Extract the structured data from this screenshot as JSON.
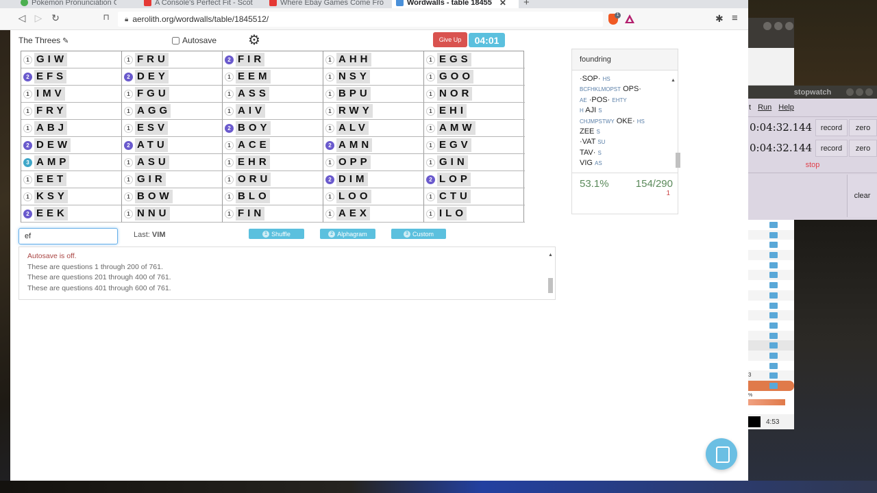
{
  "browser": {
    "tabs": [
      {
        "label": "Pokemon Pronunciation Gui",
        "favicon_color": "#4caf50"
      },
      {
        "label": "A Console's Perfect Fit - Scot",
        "favicon_color": "#e53935"
      },
      {
        "label": "Where Ebay Games Come Fro",
        "favicon_color": "#e53935"
      },
      {
        "label": "Wordwalls - table 18455",
        "favicon_color": "#4a90d9",
        "active": true
      }
    ],
    "url": "aerolith.org/wordwalls/table/1845512/",
    "brave_badge": "1"
  },
  "header": {
    "title": "The Threes",
    "autosave_label": "Autosave",
    "autosave_checked": false,
    "give_up_label": "Give Up",
    "timer": "04:01"
  },
  "grid": [
    {
      "count": 1,
      "word": "GIW"
    },
    {
      "count": 1,
      "word": "FRU"
    },
    {
      "count": 2,
      "word": "FIR"
    },
    {
      "count": 1,
      "word": "AHH"
    },
    {
      "count": 1,
      "word": "EGS"
    },
    {
      "count": 2,
      "word": "EFS"
    },
    {
      "count": 2,
      "word": "DEY"
    },
    {
      "count": 1,
      "word": "EEM"
    },
    {
      "count": 1,
      "word": "NSY"
    },
    {
      "count": 1,
      "word": "GOO"
    },
    {
      "count": 1,
      "word": "IMV"
    },
    {
      "count": 1,
      "word": "FGU"
    },
    {
      "count": 1,
      "word": "ASS"
    },
    {
      "count": 1,
      "word": "BPU"
    },
    {
      "count": 1,
      "word": "NOR"
    },
    {
      "count": 1,
      "word": "FRY"
    },
    {
      "count": 1,
      "word": "AGG"
    },
    {
      "count": 1,
      "word": "AIV"
    },
    {
      "count": 1,
      "word": "RWY"
    },
    {
      "count": 1,
      "word": "EHI"
    },
    {
      "count": 1,
      "word": "ABJ"
    },
    {
      "count": 1,
      "word": "ESV"
    },
    {
      "count": 2,
      "word": "BOY"
    },
    {
      "count": 1,
      "word": "ALV"
    },
    {
      "count": 1,
      "word": "AMW"
    },
    {
      "count": 2,
      "word": "DEW"
    },
    {
      "count": 2,
      "word": "ATU"
    },
    {
      "count": 1,
      "word": "ACE"
    },
    {
      "count": 2,
      "word": "AMN"
    },
    {
      "count": 1,
      "word": "EGV"
    },
    {
      "count": 3,
      "word": "AMP"
    },
    {
      "count": 1,
      "word": "ASU"
    },
    {
      "count": 1,
      "word": "EHR"
    },
    {
      "count": 1,
      "word": "OPP"
    },
    {
      "count": 1,
      "word": "GIN"
    },
    {
      "count": 1,
      "word": "EET"
    },
    {
      "count": 1,
      "word": "GIR"
    },
    {
      "count": 1,
      "word": "ORU"
    },
    {
      "count": 2,
      "word": "DIM"
    },
    {
      "count": 2,
      "word": "LOP"
    },
    {
      "count": 1,
      "word": "KSY"
    },
    {
      "count": 1,
      "word": "BOW"
    },
    {
      "count": 1,
      "word": "BLO"
    },
    {
      "count": 1,
      "word": "LOO"
    },
    {
      "count": 1,
      "word": "CTU"
    },
    {
      "count": 2,
      "word": "EEK"
    },
    {
      "count": 1,
      "word": "NNU"
    },
    {
      "count": 1,
      "word": "FIN"
    },
    {
      "count": 1,
      "word": "AEX"
    },
    {
      "count": 1,
      "word": "ILO"
    }
  ],
  "controls": {
    "guess_value": "ef",
    "last_label": "Last:",
    "last_word": "VIM",
    "buttons": [
      {
        "num": "1",
        "label": "Shuffle"
      },
      {
        "num": "2",
        "label": "Alphagram"
      },
      {
        "num": "3",
        "label": "Custom"
      }
    ]
  },
  "log": {
    "warning": "Autosave is off.",
    "lines": [
      "These are questions 1 through 200 of 761.",
      "These are questions 201 through 400 of 761.",
      "These are questions 401 through 600 of 761."
    ]
  },
  "solutions": {
    "user": "foundring",
    "rows": [
      {
        "front": "",
        "word": "·SOP·",
        "back": "HS"
      },
      {
        "front": "BCFHKLMOPST",
        "word": "OPS·",
        "back": ""
      },
      {
        "front": "AE",
        "word": "·POS·",
        "back": "EHTY"
      },
      {
        "front": "H",
        "word": "AJI",
        "back": "S"
      },
      {
        "front": "CHJMPSTWY",
        "word": "OKE·",
        "back": "HS"
      },
      {
        "front": "",
        "word": "ZEE",
        "back": "S"
      },
      {
        "front": "",
        "word": "·VAT",
        "back": "SU"
      },
      {
        "front": "",
        "word": "TAV·",
        "back": "S"
      },
      {
        "front": "",
        "word": "VIG",
        "back": "AS"
      }
    ],
    "percent": "53.1%",
    "score": "154/290",
    "sub": "1"
  },
  "stopwatch": {
    "title": "stopwatch",
    "menu": [
      "t",
      "Run",
      "Help"
    ],
    "times": [
      "0:04:32.144",
      "0:04:32.144"
    ],
    "record_label": "record",
    "zero_label": "zero",
    "stop_label": "stop",
    "clear_label": "clear"
  },
  "player": {
    "row_label_a": "3",
    "percent_label": "%",
    "time": "4:53"
  }
}
